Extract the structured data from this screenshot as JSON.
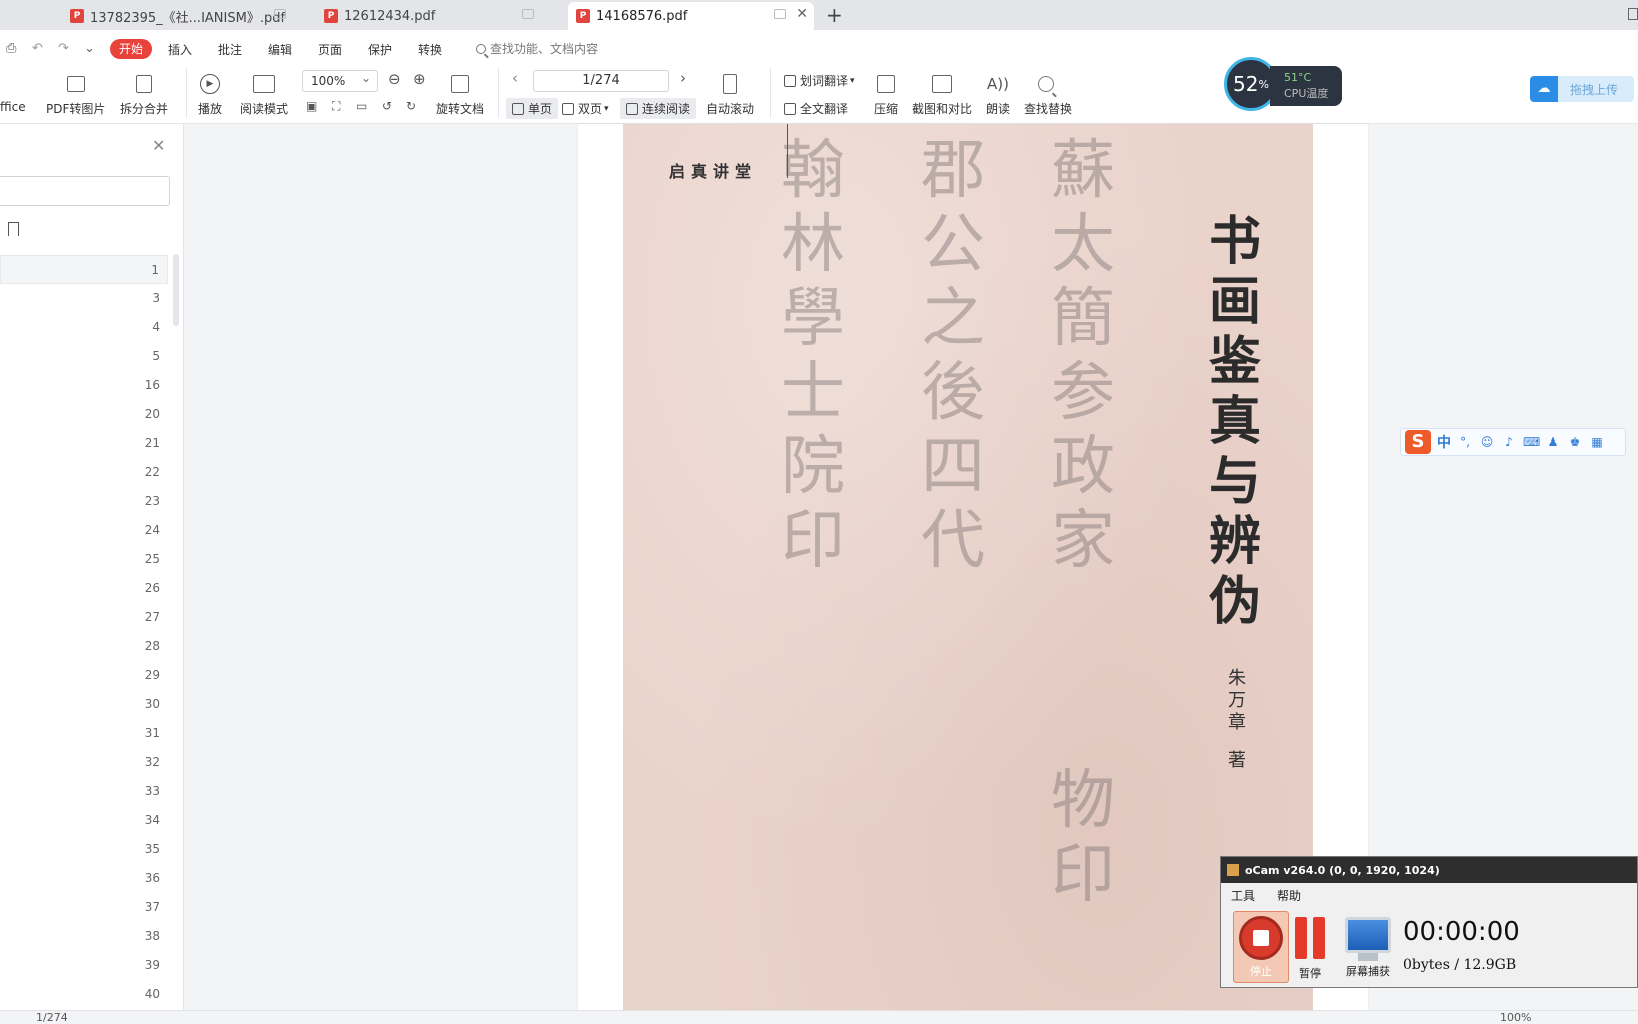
{
  "tabs": [
    {
      "title": "13782395_《社...IANISM》.pdf",
      "active": false
    },
    {
      "title": "12612434.pdf",
      "active": false
    },
    {
      "title": "14168576.pdf",
      "active": true
    }
  ],
  "menu": {
    "start": "开始",
    "insert": "插入",
    "annotate": "批注",
    "edit": "编辑",
    "page": "页面",
    "protect": "保护",
    "convert": "转换",
    "search_placeholder": "查找功能、文档内容"
  },
  "toolbar": {
    "office": "ffice",
    "pdf_to_image": "PDF转图片",
    "split_merge": "拆分合并",
    "play": "播放",
    "read_mode": "阅读模式",
    "zoom": "100%",
    "rotate_doc": "旋转文档",
    "page_indicator": "1/274",
    "single_page": "单页",
    "double_page": "双页",
    "continuous": "连续阅读",
    "auto_scroll": "自动滚动",
    "word_translate": "划词翻译",
    "full_translate": "全文翻译",
    "compress": "压缩",
    "screenshot_compare": "截图和对比",
    "read_aloud": "朗读",
    "find_replace": "查找替换",
    "upload": "拖拽上传"
  },
  "cpu": {
    "usage": "52",
    "unit": "%",
    "temp": "51°C",
    "label": "CPU温度"
  },
  "sidebar": {
    "pages": [
      "1",
      "3",
      "4",
      "5",
      "16",
      "20",
      "21",
      "22",
      "23",
      "24",
      "25",
      "26",
      "27",
      "28",
      "29",
      "30",
      "31",
      "32",
      "33",
      "34",
      "35",
      "36",
      "37",
      "38",
      "39",
      "40"
    ]
  },
  "document": {
    "series": "启真讲堂",
    "title": "书画鉴真与辨伪",
    "author": "朱万章",
    "author_role": "著",
    "calligraphy": [
      "翰林學士院印",
      "郡公之後四代",
      "蘇太簡参政家",
      "物印"
    ]
  },
  "statusbar": {
    "page": "1/274",
    "zoom": "100%"
  },
  "ime": {
    "mode": "中"
  },
  "ocam": {
    "title": "oCam v264.0 (0, 0, 1920, 1024)",
    "menu_tools": "工具",
    "menu_help": "帮助",
    "stop": "停止",
    "pause": "暂停",
    "capture": "屏幕捕获",
    "time": "00:00:00",
    "size": "0bytes / 12.9GB"
  }
}
